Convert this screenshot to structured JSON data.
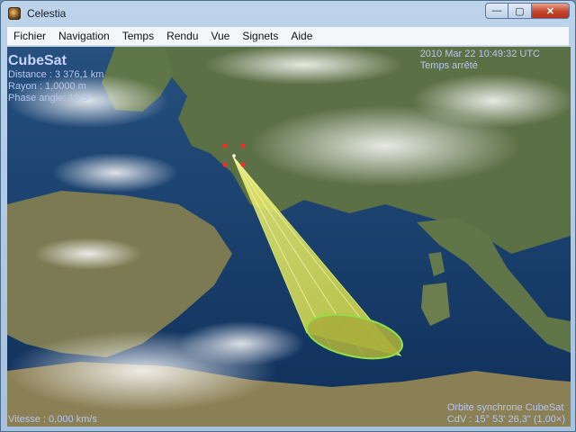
{
  "window": {
    "title": "Celestia",
    "minimize": "—",
    "maximize": "▢",
    "close": "✕"
  },
  "menu": [
    {
      "label": "Fichier"
    },
    {
      "label": "Navigation"
    },
    {
      "label": "Temps"
    },
    {
      "label": "Rendu"
    },
    {
      "label": "Vue"
    },
    {
      "label": "Signets"
    },
    {
      "label": "Aide"
    }
  ],
  "hud": {
    "object_name": "CubeSat",
    "distance": "Distance : 3 376,1 km",
    "radius": "Rayon : 1,0000 m",
    "phase_angle": "Phase angle: 10,3°",
    "datetime": "2010 Mar 22 10:49:32 UTC",
    "time_status": "Temps arrêté",
    "frame": "Orbite synchrone CubeSat",
    "fov": "CdV : 15° 53' 26,3\" (1,00×)",
    "speed": "Vitesse : 0,000 km/s"
  },
  "colors": {
    "ocean": "#173a66",
    "land": "#5d7448",
    "cone_fill": "#eef25a",
    "cone_edge": "#8fe04a",
    "selection_marker": "#ff2a2a",
    "hud_text": "#b7c6ee"
  }
}
